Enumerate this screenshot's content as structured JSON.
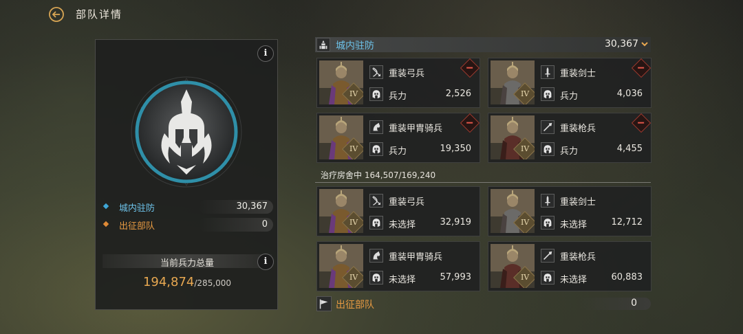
{
  "header": {
    "title": "部队详情",
    "back_icon": "back-arrow-icon"
  },
  "colors": {
    "garrison": "#6ec3ea",
    "march": "#e79a42",
    "total": "#e8a851",
    "remove": "#e4574a"
  },
  "left_panel": {
    "info_icon": "i",
    "garrison": {
      "label": "城内驻防",
      "value": "30,367"
    },
    "march": {
      "label": "出征部队",
      "value": "0"
    },
    "total_label": "当前兵力总量",
    "total_value": "194,874",
    "total_capacity": "/285,000"
  },
  "garrison_section": {
    "title": "城内驻防",
    "value": "30,367",
    "cards": [
      {
        "name": "重装弓兵",
        "type_icon": "bow-icon",
        "tier": "IV",
        "label": "兵力",
        "value": "2,526"
      },
      {
        "name": "重装剑士",
        "type_icon": "sword-icon",
        "tier": "IV",
        "label": "兵力",
        "value": "4,036"
      },
      {
        "name": "重装甲胄骑兵",
        "type_icon": "horse-icon",
        "tier": "IV",
        "label": "兵力",
        "value": "19,350"
      },
      {
        "name": "重装枪兵",
        "type_icon": "spear-icon",
        "tier": "IV",
        "label": "兵力",
        "value": "4,455"
      }
    ]
  },
  "healing": {
    "label": "治疗房舍中",
    "value": "164,507/169,240"
  },
  "healing_section": {
    "cards": [
      {
        "name": "重装弓兵",
        "type_icon": "bow-icon",
        "tier": "IV",
        "label": "未选择",
        "value": "32,919"
      },
      {
        "name": "重装剑士",
        "type_icon": "sword-icon",
        "tier": "IV",
        "label": "未选择",
        "value": "12,712"
      },
      {
        "name": "重装甲胄骑兵",
        "type_icon": "horse-icon",
        "tier": "IV",
        "label": "未选择",
        "value": "57,993"
      },
      {
        "name": "重装枪兵",
        "type_icon": "spear-icon",
        "tier": "IV",
        "label": "未选择",
        "value": "60,883"
      }
    ]
  },
  "march_section": {
    "title": "出征部队",
    "value": "0"
  }
}
